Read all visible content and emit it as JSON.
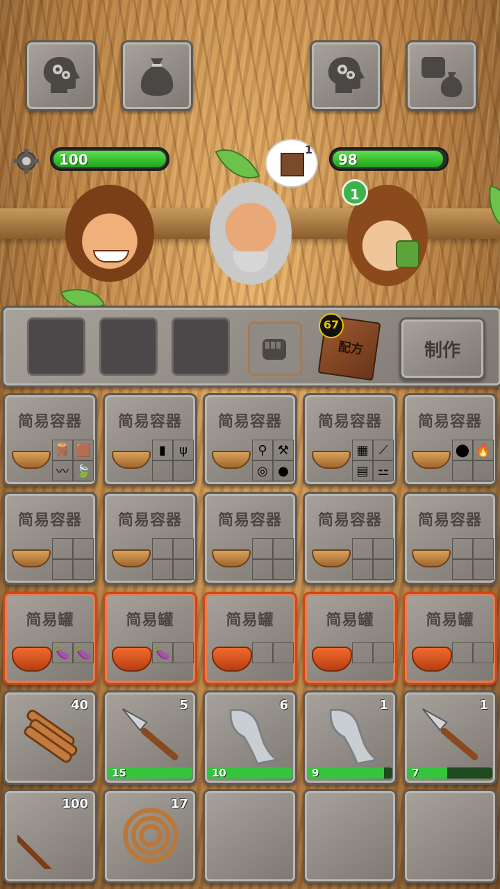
{
  "header": {
    "buttons": [
      {
        "icon": "brain-gears-icon"
      },
      {
        "icon": "sack-icon"
      },
      {
        "icon": "brain-gears-icon"
      },
      {
        "icon": "fist-sack-icon"
      }
    ]
  },
  "players": {
    "left_health": "100",
    "left_health_pct": 100,
    "right_health": "98",
    "right_health_pct": 98,
    "thought_count": "1",
    "right_badge": "1"
  },
  "craft_bar": {
    "recipe_book_badge": "67",
    "recipe_book_label": "配方",
    "make_label": "制作"
  },
  "containers": [
    {
      "title": "简易容器",
      "type": "basket",
      "items": [
        "log-icon",
        "stump-icon",
        "vine-icon",
        "leaf-icon"
      ]
    },
    {
      "title": "简易容器",
      "type": "basket",
      "items": [
        "bark-icon",
        "root-icon",
        "",
        ""
      ]
    },
    {
      "title": "简易容器",
      "type": "basket",
      "items": [
        "club-icon",
        "stone-hammer-icon",
        "rope-coil-icon",
        "rock-icon"
      ]
    },
    {
      "title": "简易容器",
      "type": "basket",
      "items": [
        "grass-mat-icon",
        "feather-icon",
        "cloth-icon",
        "bone-icon"
      ]
    },
    {
      "title": "简易容器",
      "type": "basket",
      "items": [
        "coconut-icon",
        "campfire-icon",
        "",
        ""
      ]
    },
    {
      "title": "简易容器",
      "type": "basket",
      "items": [
        "",
        "",
        "",
        ""
      ]
    },
    {
      "title": "简易容器",
      "type": "basket",
      "items": [
        "",
        "",
        "",
        ""
      ]
    },
    {
      "title": "简易容器",
      "type": "basket",
      "items": [
        "",
        "",
        "",
        ""
      ]
    },
    {
      "title": "简易容器",
      "type": "basket",
      "items": [
        "",
        "",
        "",
        ""
      ]
    },
    {
      "title": "简易容器",
      "type": "basket",
      "items": [
        "",
        "",
        "",
        ""
      ]
    }
  ],
  "jars": [
    {
      "title": "简易罐",
      "items": [
        "eggplant-icon",
        "eggplant-icon"
      ]
    },
    {
      "title": "简易罐",
      "items": [
        "eggplant-icon",
        ""
      ]
    },
    {
      "title": "简易罐",
      "items": [
        "",
        ""
      ]
    },
    {
      "title": "简易罐",
      "items": [
        "",
        ""
      ]
    },
    {
      "title": "简易罐",
      "items": [
        "",
        ""
      ]
    }
  ],
  "inventory": [
    {
      "icon": "wood-planks-icon",
      "count": "40",
      "durability": null
    },
    {
      "icon": "stone-spear-icon",
      "count": "5",
      "durability": "15",
      "durability_pct": 100
    },
    {
      "icon": "stone-axe-icon",
      "count": "6",
      "durability": "10",
      "durability_pct": 100
    },
    {
      "icon": "stone-axe-icon",
      "count": "1",
      "durability": "9",
      "durability_pct": 90
    },
    {
      "icon": "stone-spear-icon",
      "count": "1",
      "durability": "7",
      "durability_pct": 47
    },
    {
      "icon": "stick-icon",
      "count": "100",
      "durability": null
    },
    {
      "icon": "rope-coil-icon",
      "count": "17",
      "durability": null
    },
    {
      "icon": "",
      "count": "",
      "durability": null
    },
    {
      "icon": "",
      "count": "",
      "durability": null
    },
    {
      "icon": "",
      "count": "",
      "durability": null
    }
  ],
  "colors": {
    "health": "#2cc22a",
    "stone": "#8f8a83",
    "jar_border": "#e0703c"
  }
}
